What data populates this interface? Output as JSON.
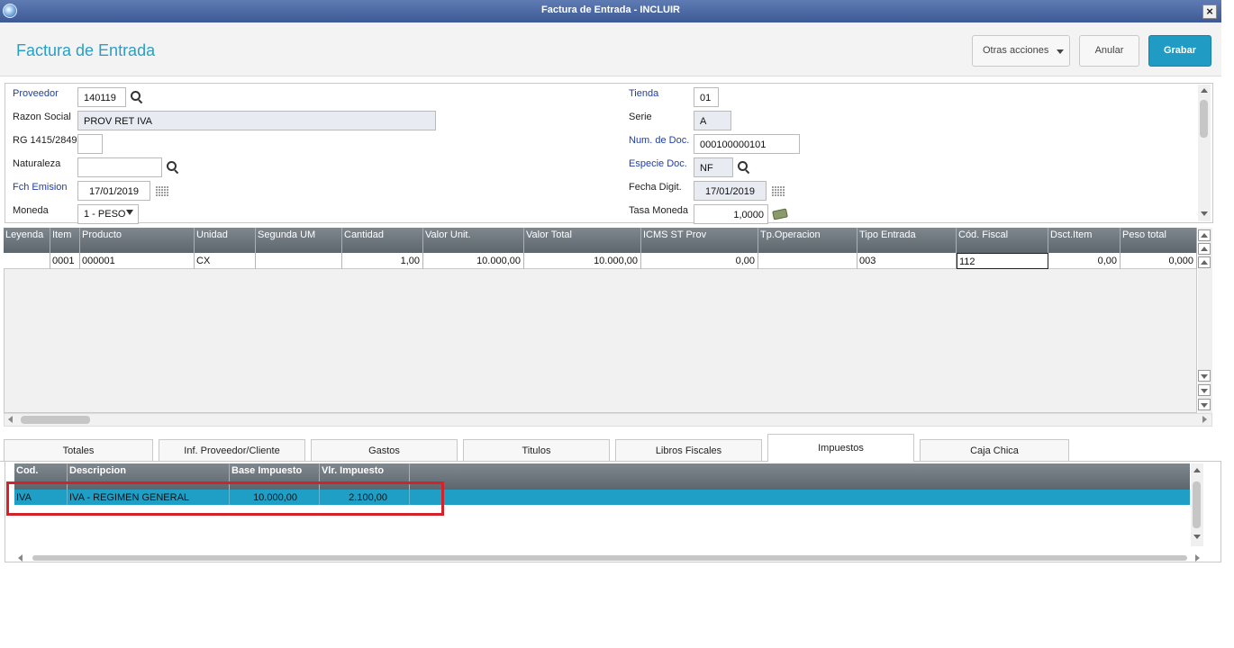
{
  "window": {
    "title": "Factura de Entrada - INCLUIR",
    "close_label": "×"
  },
  "header": {
    "page_title": "Factura de Entrada",
    "otras_label": "Otras acciones",
    "anular_label": "Anular",
    "grabar_label": "Grabar"
  },
  "form": {
    "proveedor": {
      "label": "Proveedor",
      "value": "140119"
    },
    "razon_social": {
      "label": "Razon Social",
      "value": "PROV RET IVA"
    },
    "rg": {
      "label": "RG 1415/2849",
      "value": ""
    },
    "naturaleza": {
      "label": "Naturaleza",
      "value": ""
    },
    "fch_emision": {
      "label": "Fch Emision",
      "value": "17/01/2019"
    },
    "moneda": {
      "label": "Moneda",
      "value": "1 - PESO"
    },
    "tienda": {
      "label": "Tienda",
      "value": "01"
    },
    "serie": {
      "label": "Serie",
      "value": "A"
    },
    "num_doc": {
      "label": "Num. de Doc.",
      "value": "000100000101"
    },
    "especie_doc": {
      "label": "Especie Doc.",
      "value": "NF"
    },
    "fecha_digit": {
      "label": "Fecha Digit.",
      "value": "17/01/2019"
    },
    "tasa_moneda": {
      "label": "Tasa Moneda",
      "value": "1,0000"
    }
  },
  "grid": {
    "columns": [
      "Leyenda",
      "Item",
      "Producto",
      "Unidad",
      "Segunda UM",
      "Cantidad",
      "Valor Unit.",
      "Valor Total",
      "ICMS ST Prov",
      "Tp.Operacion",
      "Tipo Entrada",
      "Cód. Fiscal",
      "Dsct.Item",
      "Peso total"
    ],
    "row": [
      "",
      "0001",
      "000001",
      "CX",
      "",
      "1,00",
      "10.000,00",
      "10.000,00",
      "0,00",
      "",
      "003",
      "112",
      "0,00",
      "0,000"
    ]
  },
  "tabs": [
    "Totales",
    "Inf. Proveedor/Cliente",
    "Gastos",
    "Titulos",
    "Libros Fiscales",
    "Impuestos",
    "Caja Chica"
  ],
  "active_tab": "Impuestos",
  "taxes": {
    "columns": [
      "Cod.",
      "Descripcion",
      "Base Impuesto",
      "Vlr. Impuesto"
    ],
    "row": [
      "IVA",
      "IVA - REGIMEN GENERAL",
      "10.000,00",
      "2.100,00"
    ]
  },
  "colors": {
    "accent": "#2a9fc4",
    "grabar": "#1f9bc4",
    "selected_row": "#1f9fc6",
    "highlight": "#d2232a",
    "required_label": "#1e3ea8"
  }
}
